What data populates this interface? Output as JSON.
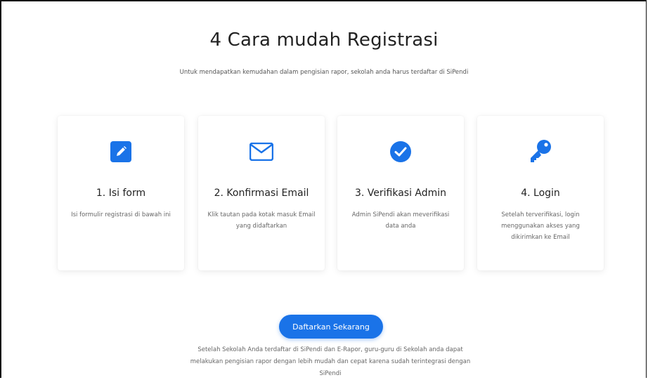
{
  "header": {
    "title": "4 Cara mudah Registrasi",
    "subtitle": "Untuk mendapatkan kemudahan dalam pengisian rapor, sekolah anda harus terdaftar di SiPendi"
  },
  "steps": [
    {
      "icon": "edit-icon",
      "title": "1. Isi form",
      "desc": "Isi formulir registrasi di bawah ini"
    },
    {
      "icon": "envelope-icon",
      "title": "2. Konfirmasi Email",
      "desc": "Klik tautan pada kotak masuk Email yang didaftarkan"
    },
    {
      "icon": "check-circle-icon",
      "title": "3. Verifikasi Admin",
      "desc": "Admin SiPendi akan meverifikasi data anda"
    },
    {
      "icon": "key-icon",
      "title": "4. Login",
      "desc": "Setelah terverifikasi, login menggunakan akses yang dikirimkan ke Email"
    }
  ],
  "cta": {
    "label": "Daftarkan Sekarang"
  },
  "footer": {
    "text": "Setelah Sekolah Anda terdaftar di SiPendi dan E-Rapor, guru-guru di Sekolah anda dapat melakukan pengisian rapor dengan lebih mudah dan cepat karena sudah terintegrasi dengan SiPendi"
  },
  "colors": {
    "accent": "#1a73e8"
  }
}
